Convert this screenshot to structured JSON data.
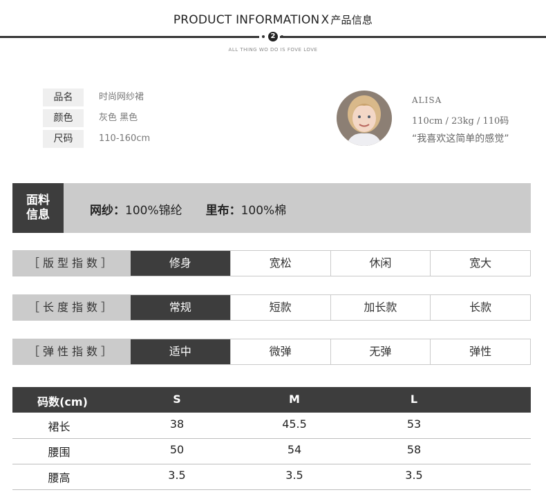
{
  "header": {
    "title": "PRODUCT INFORMATION",
    "title_cn": "产品信息",
    "separator": "X",
    "badge": "2",
    "subtitle": "ALL THING WO DO IS FOVE LOVE"
  },
  "product": {
    "rows": [
      {
        "label": "品名",
        "value": "时尚网纱裙"
      },
      {
        "label": "颜色",
        "value": "灰色 黑色"
      },
      {
        "label": "尺码",
        "value": "110-160cm"
      }
    ]
  },
  "model": {
    "name": "ALISA",
    "stats": "110cm / 23kg / 110码",
    "quote": "“我喜欢这简单的感觉”"
  },
  "fabric": {
    "tag_line1": "面料",
    "tag_line2": "信息",
    "main_label": "网纱：",
    "main_value": "100%锦纶",
    "lining_label": "里布：",
    "lining_value": "100%棉"
  },
  "indices": [
    {
      "label": "［版型指数］",
      "options": [
        "修身",
        "宽松",
        "休闲",
        "宽大"
      ],
      "selected": 0
    },
    {
      "label": "［长度指数］",
      "options": [
        "常规",
        "短款",
        "加长款",
        "长款"
      ],
      "selected": 0
    },
    {
      "label": "［弹性指数］",
      "options": [
        "适中",
        "微弹",
        "无弹",
        "弹性"
      ],
      "selected": 0
    }
  ],
  "size_table": {
    "header": [
      "码数(cm)",
      "S",
      "M",
      "L"
    ],
    "rows": [
      [
        "裙长",
        "38",
        "45.5",
        "53"
      ],
      [
        "腰围",
        "50",
        "54",
        "58"
      ],
      [
        "腰高",
        "3.5",
        "3.5",
        "3.5"
      ]
    ]
  },
  "colors": {
    "dark": "#3d3d3d",
    "light_gray": "#cbcbcb"
  }
}
